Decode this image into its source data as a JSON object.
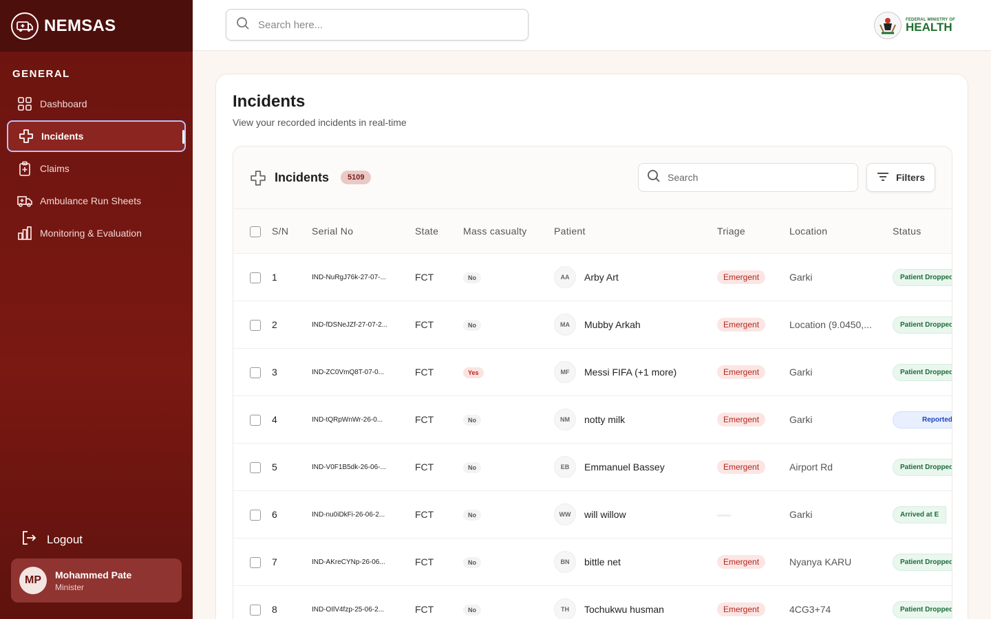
{
  "brand": {
    "name": "NEMSAS"
  },
  "sidebar": {
    "section": "GENERAL",
    "items": [
      {
        "label": "Dashboard",
        "icon": "grid-icon"
      },
      {
        "label": "Incidents",
        "icon": "cross-icon"
      },
      {
        "label": "Claims",
        "icon": "clipboard-plus-icon"
      },
      {
        "label": "Ambulance Run Sheets",
        "icon": "ambulance-icon"
      },
      {
        "label": "Monitoring & Evaluation",
        "icon": "bar-chart-icon"
      }
    ],
    "logout": "Logout",
    "user": {
      "initials": "MP",
      "name": "Mohammed Pate",
      "role": "Minister"
    }
  },
  "topbar": {
    "search_placeholder": "Search here...",
    "ministry_small": "FEDERAL MINISTRY OF",
    "ministry_big": "HEALTH"
  },
  "page": {
    "title": "Incidents",
    "subtitle": "View your recorded incidents in real-time"
  },
  "table": {
    "title": "Incidents",
    "count": "5109",
    "search_placeholder": "Search",
    "filters_label": "Filters",
    "columns": [
      "S/N",
      "Serial No",
      "State",
      "Mass casualty",
      "Patient",
      "Triage",
      "Location",
      "Status"
    ],
    "rows": [
      {
        "sn": "1",
        "serial": "IND-NuRgJ76k-27-07-...",
        "state": "FCT",
        "mass": "No",
        "initials": "AA",
        "patient": "Arby Art",
        "triage": "Emergent",
        "location": "Garki",
        "status": "Patient Dropped",
        "status_type": "green"
      },
      {
        "sn": "2",
        "serial": "IND-fDSNeJZf-27-07-2...",
        "state": "FCT",
        "mass": "No",
        "initials": "MA",
        "patient": "Mubby Arkah",
        "triage": "Emergent",
        "location": "Location (9.0450,...",
        "status": "Patient Dropped",
        "status_type": "green"
      },
      {
        "sn": "3",
        "serial": "IND-ZC0VmQ8T-07-0...",
        "state": "FCT",
        "mass": "Yes",
        "initials": "MF",
        "patient": "Messi FIFA (+1 more)",
        "triage": "Emergent",
        "location": "Garki",
        "status": "Patient Dropped",
        "status_type": "green"
      },
      {
        "sn": "4",
        "serial": "IND-tQRpWnWr-26-0...",
        "state": "FCT",
        "mass": "No",
        "initials": "NM",
        "patient": "notty milk",
        "triage": "Emergent",
        "location": "Garki",
        "status": "Reported",
        "status_type": "blue"
      },
      {
        "sn": "5",
        "serial": "IND-V0F1B5dk-26-06-...",
        "state": "FCT",
        "mass": "No",
        "initials": "EB",
        "patient": "Emmanuel Bassey",
        "triage": "Emergent",
        "location": "Airport Rd",
        "status": "Patient Dropped",
        "status_type": "green"
      },
      {
        "sn": "6",
        "serial": "IND-nu0iDkFi-26-06-2...",
        "state": "FCT",
        "mass": "No",
        "initials": "WW",
        "patient": "will willow",
        "triage": "",
        "location": "Garki",
        "status": "Arrived at E",
        "status_type": "green"
      },
      {
        "sn": "7",
        "serial": "IND-AKreCYNp-26-06...",
        "state": "FCT",
        "mass": "No",
        "initials": "BN",
        "patient": "bittle net",
        "triage": "Emergent",
        "location": "Nyanya KARU",
        "status": "Patient Dropped",
        "status_type": "green"
      },
      {
        "sn": "8",
        "serial": "IND-OIlV4fzp-25-06-2...",
        "state": "FCT",
        "mass": "No",
        "initials": "TH",
        "patient": "Tochukwu husman",
        "triage": "Emergent",
        "location": "4CG3+74",
        "status": "Patient Dropped",
        "status_type": "green"
      }
    ]
  },
  "colors": {
    "sidebar": "#6b1410",
    "accent": "#b3261e",
    "active_border": "#b9c3ff"
  }
}
